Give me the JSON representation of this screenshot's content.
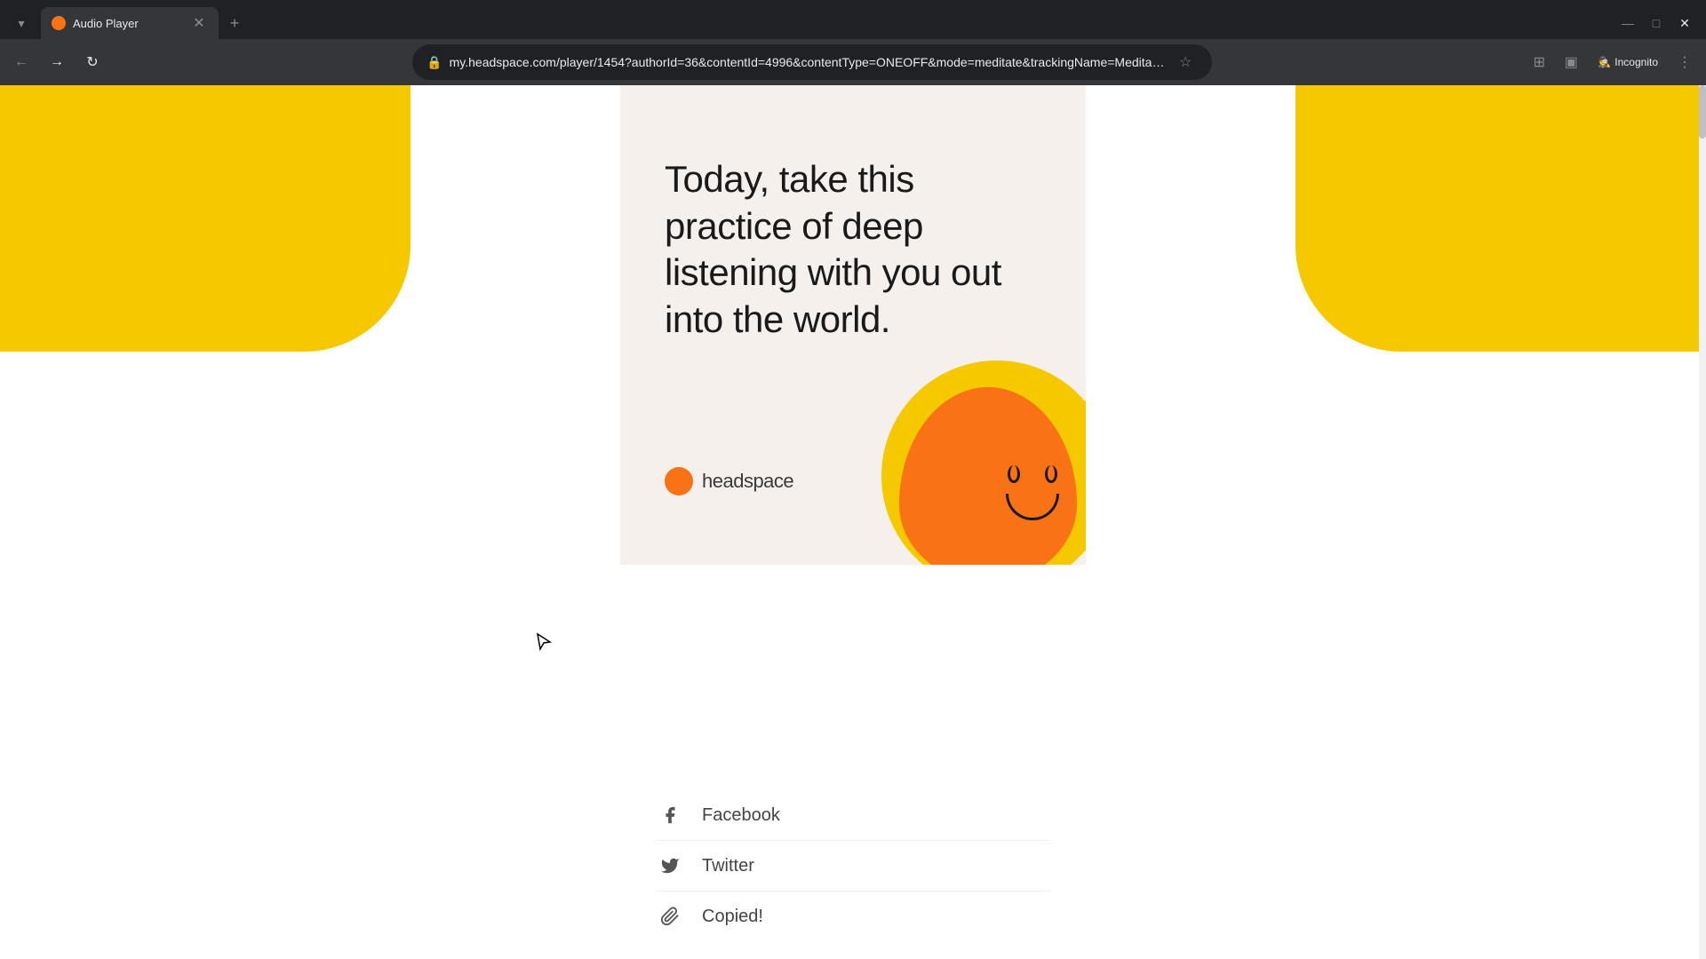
{
  "browser": {
    "tab_title": "Audio Player",
    "tab_favicon_color": "#f97316",
    "url": "my.headspace.com/player/1454?authorId=36&contentId=4996&contentType=ONEOFF&mode=meditate&trackingName=Meditation",
    "incognito_label": "Incognito"
  },
  "page": {
    "card_text": "Today, take this practice of deep listening with you out into the world.",
    "headspace_logo_text": "headspace",
    "social_items": [
      {
        "id": "facebook",
        "label": "Facebook",
        "icon": "f"
      },
      {
        "id": "twitter",
        "label": "Twitter",
        "icon": "t"
      },
      {
        "id": "copy",
        "label": "Copied!",
        "icon": "📎"
      }
    ]
  },
  "icons": {
    "back_arrow": "←",
    "forward_arrow": "→",
    "reload": "↻",
    "lock": "🔒",
    "star": "☆",
    "extension": "⊞",
    "sidebar": "▣",
    "incognito": "🕵",
    "minimize": "—",
    "maximize": "□",
    "close": "✕",
    "new_tab": "+",
    "down_arrow": "▾",
    "more": "⋮"
  }
}
